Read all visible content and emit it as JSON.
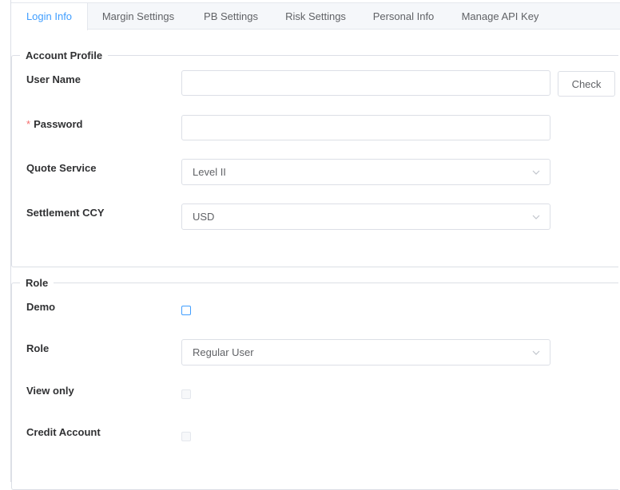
{
  "tabs": [
    {
      "label": "Login Info",
      "active": true
    },
    {
      "label": "Margin Settings",
      "active": false
    },
    {
      "label": "PB Settings",
      "active": false
    },
    {
      "label": "Risk Settings",
      "active": false
    },
    {
      "label": "Personal Info",
      "active": false
    },
    {
      "label": "Manage API Key",
      "active": false
    }
  ],
  "account_profile": {
    "legend": "Account Profile",
    "user_name_label": "User Name",
    "user_name_value": "",
    "check_button": "Check",
    "password_required_mark": "*",
    "password_label": "Password",
    "password_value": "",
    "quote_service_label": "Quote Service",
    "quote_service_value": "Level II",
    "settlement_ccy_label": "Settlement CCY",
    "settlement_ccy_value": "USD"
  },
  "role_section": {
    "legend": "Role",
    "demo_label": "Demo",
    "demo_checked": false,
    "role_label": "Role",
    "role_value": "Regular User",
    "view_only_label": "View only",
    "view_only_checked": false,
    "credit_account_label": "Credit Account",
    "credit_account_checked": false
  },
  "colors": {
    "accent": "#409eff",
    "required": "#f56c6c",
    "border": "#dcdfe6"
  },
  "icons": {
    "select_arrow": "chevron-down-icon"
  }
}
